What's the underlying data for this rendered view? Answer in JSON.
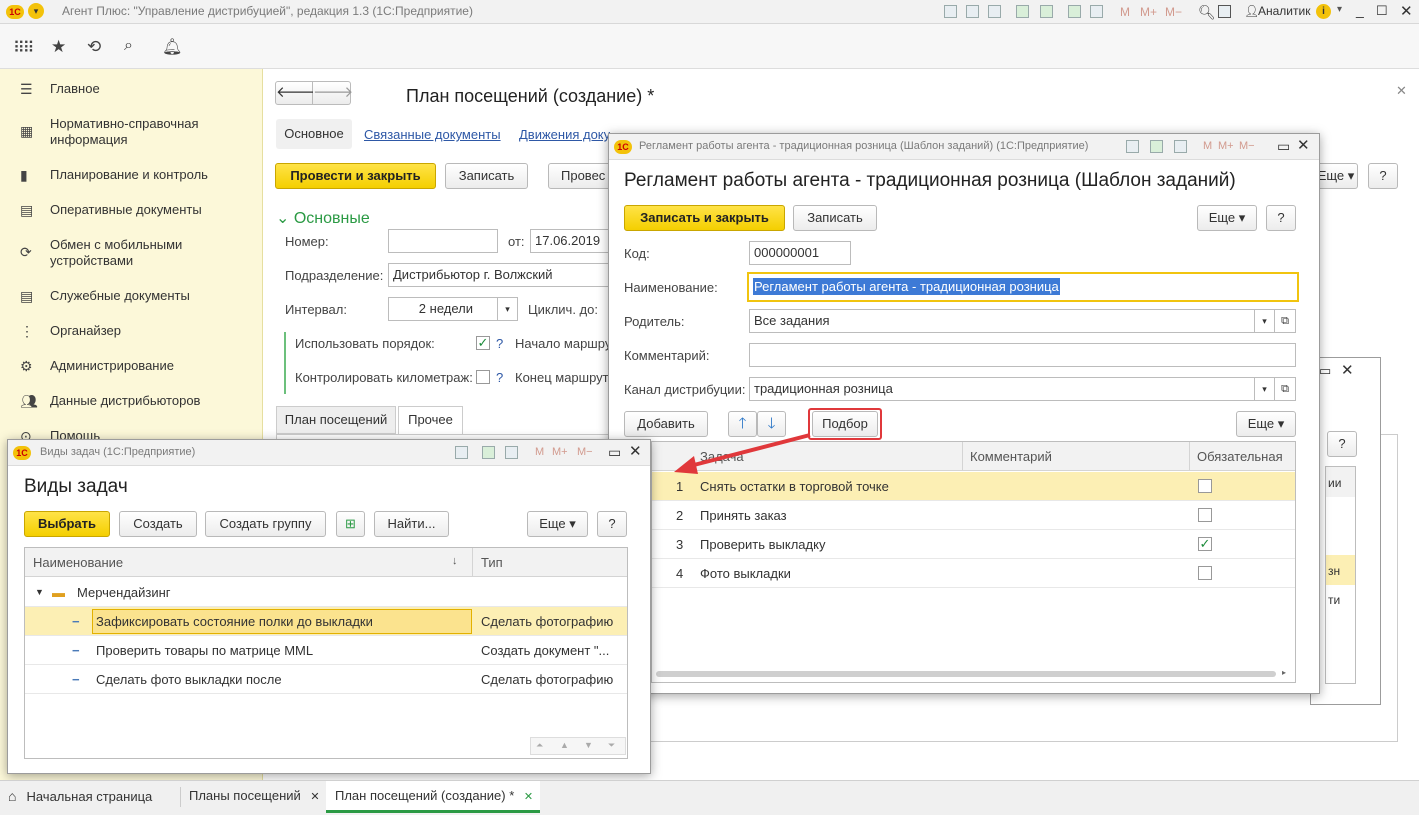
{
  "app_title": "Агент Плюс: \"Управление дистрибуцией\", редакция 1.3  (1С:Предприятие)",
  "logo_text": "1С",
  "user_name": "Аналитик",
  "sidebar": {
    "items": [
      {
        "label": "Главное",
        "icon": "menu-icon"
      },
      {
        "label": "Нормативно-справочная информация",
        "icon": "list-icon"
      },
      {
        "label": "Планирование и контроль",
        "icon": "chart-icon"
      },
      {
        "label": "Оперативные документы",
        "icon": "documents-icon"
      },
      {
        "label": "Обмен с мобильными устройствами",
        "icon": "sync-icon"
      },
      {
        "label": "Служебные документы",
        "icon": "documents-icon"
      },
      {
        "label": "Органайзер",
        "icon": "organizer-icon"
      },
      {
        "label": "Администрирование",
        "icon": "gear-icon"
      },
      {
        "label": "Данные дистрибьюторов",
        "icon": "people-icon"
      },
      {
        "label": "Помощь",
        "icon": "help-icon"
      }
    ]
  },
  "main": {
    "title": "План посещений  (создание) *",
    "tabs": [
      "Основное",
      "Связанные документы",
      "Движения доку"
    ],
    "post_close": "Провести и закрыть",
    "save": "Записать",
    "post": "Провес",
    "more": "Еще",
    "help": "?",
    "section": "Основные",
    "number_label": "Номер:",
    "number_value": "",
    "from_label": "от:",
    "date_value": "17.06.2019",
    "division_label": "Подразделение:",
    "division_value": "Дистрибьютор г. Волжский",
    "interval_label": "Интервал:",
    "interval_value": "2 недели",
    "cyclic_label": "Циклич. до:",
    "use_order_label": "Использовать порядок:",
    "start_route": "Начало маршру",
    "control_km_label": "Контролировать километраж:",
    "end_route": "Конец маршрут",
    "subtabs": [
      "План посещений",
      "Прочее"
    ]
  },
  "reglament": {
    "window_title": "Регламент работы агента - традиционная розница (Шаблон заданий)  (1С:Предприятие)",
    "heading": "Регламент работы агента - традиционная розница (Шаблон заданий)",
    "save_close": "Записать и закрыть",
    "save": "Записать",
    "more": "Еще",
    "help": "?",
    "code_label": "Код:",
    "code_value": "000000001",
    "name_label": "Наименование:",
    "name_value": "Регламент работы агента - традиционная розница",
    "parent_label": "Родитель:",
    "parent_value": "Все задания",
    "comment_label": "Комментарий:",
    "comment_value": "",
    "channel_label": "Канал дистрибуции:",
    "channel_value": "традиционная розница",
    "add": "Добавить",
    "pick": "Подбор",
    "columns": [
      "Задача",
      "Комментарий",
      "Обязательная"
    ],
    "rows": [
      {
        "n": "1",
        "task": "Снять остатки в торговой точке",
        "comment": "",
        "required": false
      },
      {
        "n": "2",
        "task": "Принять заказ",
        "comment": "",
        "required": false
      },
      {
        "n": "3",
        "task": "Проверить выкладку",
        "comment": "",
        "required": true
      },
      {
        "n": "4",
        "task": "Фото выкладки",
        "comment": "",
        "required": false
      }
    ]
  },
  "bg_window": {
    "help": "?",
    "frag1": "ии",
    "frag2": "зн",
    "frag3": "ти"
  },
  "task_types": {
    "window_title": "Виды задач  (1С:Предприятие)",
    "heading": "Виды задач",
    "select": "Выбрать",
    "create": "Создать",
    "create_group": "Создать группу",
    "find": "Найти...",
    "more": "Еще",
    "help": "?",
    "col_name": "Наименование",
    "col_type": "Тип",
    "group": "Мерчендайзинг",
    "rows": [
      {
        "name": "Зафиксировать состояние полки до выкладки",
        "type": "Сделать фотографию"
      },
      {
        "name": "Проверить товары по матрице MML",
        "type": "Создать документ \"..."
      },
      {
        "name": "Сделать фото  выкладки после",
        "type": "Сделать фотографию"
      }
    ]
  },
  "bottom_tabs": [
    "Начальная страница",
    "Планы посещений",
    "План посещений  (создание) *"
  ],
  "colors": {
    "accent_yellow": "#f4cf00",
    "sidebar_bg": "#fcf8d9",
    "highlight_red": "#e0383b",
    "selected_row": "#fcefb4"
  }
}
